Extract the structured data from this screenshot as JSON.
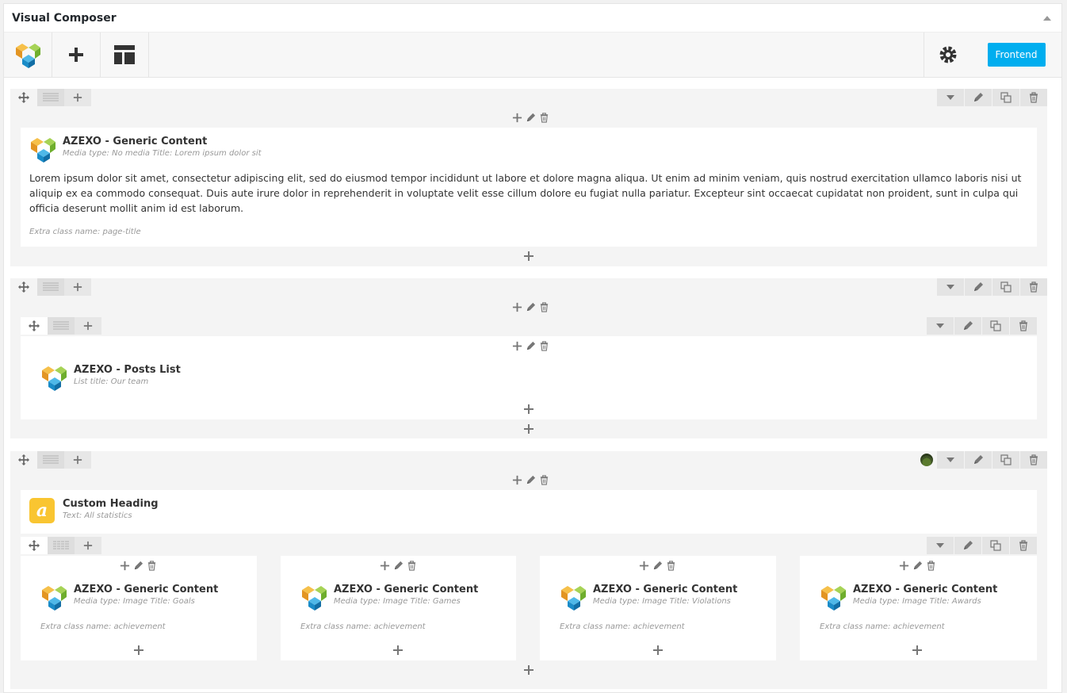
{
  "panel": {
    "title": "Visual Composer"
  },
  "toolbar": {
    "frontend_label": "Frontend"
  },
  "rows": [
    {
      "element": {
        "title": "AZEXO - Generic Content",
        "subtitle": "Media type: No media  Title: Lorem ipsum dolor sit",
        "body": "Lorem ipsum dolor sit amet, consectetur adipiscing elit, sed do eiusmod tempor incididunt ut labore et dolore magna aliqua. Ut enim ad minim veniam, quis nostrud exercitation ullamco laboris nisi ut aliquip ex ea commodo consequat. Duis aute irure dolor in reprehenderit in voluptate velit esse cillum dolore eu fugiat nulla pariatur. Excepteur sint occaecat cupidatat non proident, sunt in culpa qui officia deserunt mollit anim id est laborum.",
        "extra": "Extra class name: page-title"
      }
    },
    {
      "element": {
        "title": "AZEXO - Posts List",
        "subtitle": "List title: Our team"
      }
    },
    {
      "heading": {
        "icon_letter": "a",
        "title": "Custom Heading",
        "subtitle": "Text: All statistics"
      },
      "columns": [
        {
          "title": "AZEXO - Generic Content",
          "subtitle": "Media type: Image  Title: Goals",
          "extra": "Extra class name: achievement"
        },
        {
          "title": "AZEXO - Generic Content",
          "subtitle": "Media type: Image  Title: Games",
          "extra": "Extra class name: achievement"
        },
        {
          "title": "AZEXO - Generic Content",
          "subtitle": "Media type: Image  Title: Violations",
          "extra": "Extra class name: achievement"
        },
        {
          "title": "AZEXO - Generic Content",
          "subtitle": "Media type: Image  Title: Awards",
          "extra": "Extra class name: achievement"
        }
      ]
    }
  ],
  "colors": {
    "accent": "#00aeef",
    "heading_icon": "#f9c531",
    "logo_orange": "#f0a030",
    "logo_green": "#8cc63f",
    "logo_blue": "#1ea0dc"
  },
  "icons": [
    "vc-logo-icon",
    "add-element-icon",
    "templates-icon",
    "gear-icon",
    "move-icon",
    "layout-icon",
    "add-icon",
    "toggle-icon",
    "edit-icon",
    "clone-icon",
    "delete-icon",
    "collapse-icon"
  ]
}
